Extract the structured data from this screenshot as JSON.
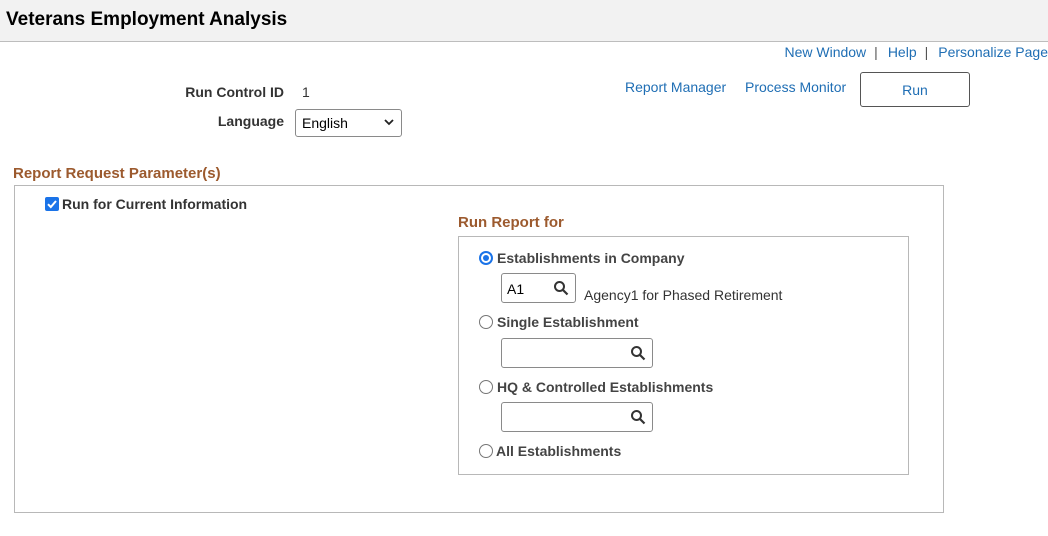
{
  "header": {
    "title": "Veterans Employment Analysis"
  },
  "top_links": {
    "new_window": "New Window",
    "help": "Help",
    "personalize": "Personalize Page",
    "separator": "|"
  },
  "run_control": {
    "id_label": "Run Control ID",
    "id_value": "1",
    "language_label": "Language",
    "language_value": "English",
    "report_manager": "Report Manager",
    "process_monitor": "Process Monitor",
    "run_button": "Run"
  },
  "params": {
    "section_title": "Report Request Parameter(s)",
    "current_info_label": "Run for Current Information",
    "current_info_checked": true,
    "run_report_for": {
      "title": "Run Report for",
      "options": [
        {
          "label": "Establishments in Company",
          "selected": true,
          "field_value": "A1",
          "description": "Agency1 for Phased Retirement"
        },
        {
          "label": "Single Establishment",
          "selected": false,
          "field_value": ""
        },
        {
          "label": "HQ & Controlled Establishments",
          "selected": false,
          "field_value": ""
        },
        {
          "label": "All Establishments",
          "selected": false
        }
      ]
    }
  },
  "colors": {
    "link": "#1f6eb4",
    "section_title": "#9c5a2e",
    "accent": "#1a73e8"
  },
  "icons": {
    "lookup": "magnifier-icon",
    "dropdown": "chevron-down-icon",
    "check": "checkmark-icon"
  }
}
